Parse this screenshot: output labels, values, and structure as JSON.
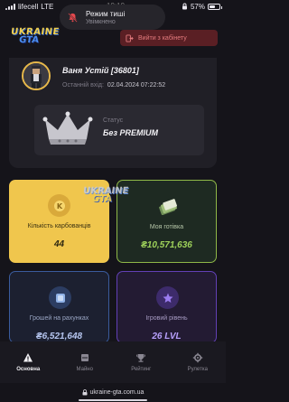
{
  "status_bar": {
    "carrier": "lifecell",
    "network": "LTE",
    "time": "19:19",
    "battery": "57%"
  },
  "toast": {
    "title": "Режим тиші",
    "subtitle": "Увімкнено"
  },
  "header": {
    "logo_line1": "UKRAINE",
    "logo_line2": "GTA",
    "logout_label": "Вийти з кабінету"
  },
  "profile": {
    "username": "Ваня Устій [36801]",
    "last_login_label": "Останній вхід:",
    "last_login_value": "02.04.2024 07:22:52",
    "status_label": "Статус",
    "status_value": "Без PREMIUM"
  },
  "watermark": {
    "line1": "UKRAINE",
    "line2": "GTA"
  },
  "stats": {
    "coins": {
      "label": "Кількість карбованців",
      "value": "44"
    },
    "cash": {
      "label": "Моя готівка",
      "value": "₴10,571,636"
    },
    "bank": {
      "label": "Грошей на рахунках",
      "value": "₴6,521,648"
    },
    "level": {
      "label": "Ігровий рівень",
      "value": "26 LVL"
    }
  },
  "nav": [
    {
      "label": "Основна",
      "icon": "warning-icon",
      "active": true
    },
    {
      "label": "Майно",
      "icon": "box-icon",
      "active": false
    },
    {
      "label": "Рейтинг",
      "icon": "trophy-icon",
      "active": false
    },
    {
      "label": "Рулетка",
      "icon": "gear-icon",
      "active": false
    }
  ],
  "browser": {
    "url": "ukraine-gta.com.ua"
  },
  "colors": {
    "background": "#15141a",
    "card_coins": "#f0c64d",
    "cash_accent": "#9ed25a",
    "bank_accent": "#3a5b9d",
    "level_accent": "#6240b5",
    "logout_bg": "#5a1f24"
  }
}
